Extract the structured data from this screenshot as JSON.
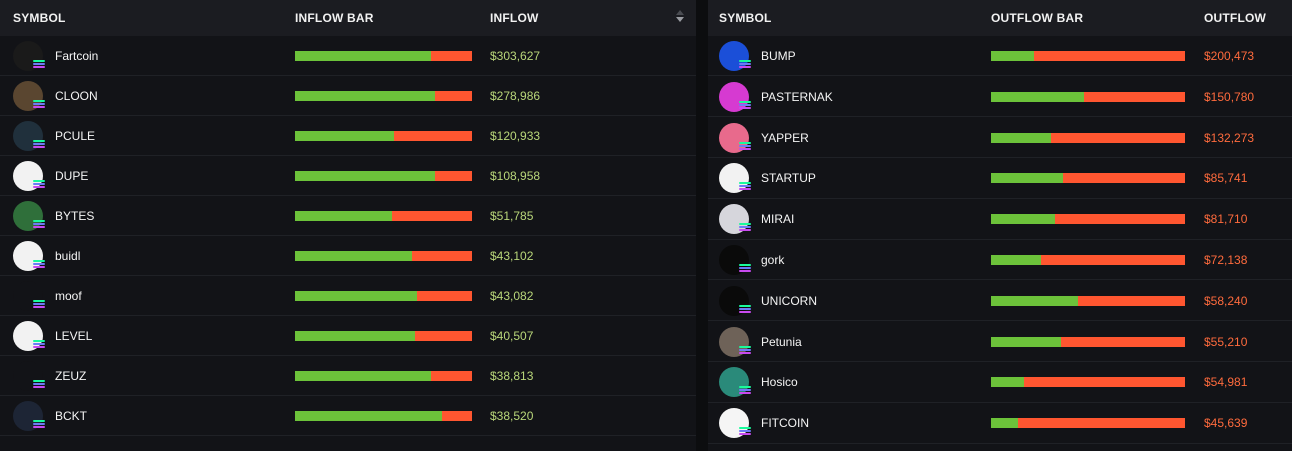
{
  "inflow_table": {
    "headers": {
      "symbol": "SYMBOL",
      "bar": "INFLOW BAR",
      "value": "INFLOW"
    },
    "rows": [
      {
        "symbol": "Fartcoin",
        "value": "$303,627",
        "green_fraction": 0.77,
        "avatar_color": "#1a1a1a"
      },
      {
        "symbol": "CLOON",
        "value": "$278,986",
        "green_fraction": 0.79,
        "avatar_color": "#5a4630"
      },
      {
        "symbol": "PCULE",
        "value": "$120,933",
        "green_fraction": 0.56,
        "avatar_color": "#20303c"
      },
      {
        "symbol": "DUPE",
        "value": "$108,958",
        "green_fraction": 0.79,
        "avatar_color": "#f2f2f2"
      },
      {
        "symbol": "BYTES",
        "value": "$51,785",
        "green_fraction": 0.55,
        "avatar_color": "#2f6f3a"
      },
      {
        "symbol": "buidl",
        "value": "$43,102",
        "green_fraction": 0.66,
        "avatar_color": "#f2f2f2"
      },
      {
        "symbol": "moof",
        "value": "$43,082",
        "green_fraction": 0.69,
        "avatar_color": "#121317"
      },
      {
        "symbol": "LEVEL",
        "value": "$40,507",
        "green_fraction": 0.68,
        "avatar_color": "#f2f2f2"
      },
      {
        "symbol": "ZEUZ",
        "value": "$38,813",
        "green_fraction": 0.77,
        "avatar_color": "#121317"
      },
      {
        "symbol": "BCKT",
        "value": "$38,520",
        "green_fraction": 0.83,
        "avatar_color": "#1d2535"
      }
    ]
  },
  "outflow_table": {
    "headers": {
      "symbol": "SYMBOL",
      "bar": "OUTFLOW BAR",
      "value": "OUTFLOW"
    },
    "rows": [
      {
        "symbol": "BUMP",
        "value": "$200,473",
        "green_fraction": 0.22,
        "avatar_color": "#1b4fd8"
      },
      {
        "symbol": "PASTERNAK",
        "value": "$150,780",
        "green_fraction": 0.48,
        "avatar_color": "#d63ad1"
      },
      {
        "symbol": "YAPPER",
        "value": "$132,273",
        "green_fraction": 0.31,
        "avatar_color": "#e86a8c"
      },
      {
        "symbol": "STARTUP",
        "value": "$85,741",
        "green_fraction": 0.37,
        "avatar_color": "#f2f2f2"
      },
      {
        "symbol": "MIRAI",
        "value": "$81,710",
        "green_fraction": 0.33,
        "avatar_color": "#d6d6dc"
      },
      {
        "symbol": "gork",
        "value": "$72,138",
        "green_fraction": 0.26,
        "avatar_color": "#0a0a0a"
      },
      {
        "symbol": "UNICORN",
        "value": "$58,240",
        "green_fraction": 0.45,
        "avatar_color": "#0a0a0a"
      },
      {
        "symbol": "Petunia",
        "value": "$55,210",
        "green_fraction": 0.36,
        "avatar_color": "#6e6258"
      },
      {
        "symbol": "Hosico",
        "value": "$54,981",
        "green_fraction": 0.17,
        "avatar_color": "#2a8a7a"
      },
      {
        "symbol": "FITCOIN",
        "value": "$45,639",
        "green_fraction": 0.14,
        "avatar_color": "#f5f5f5"
      }
    ]
  },
  "colors": {
    "inflow": "#6cc23a",
    "outflow": "#ff5630",
    "inflow_text": "#b9d77a",
    "outflow_text": "#ff6b3d"
  },
  "icons": {
    "sort": "sort-desc-icon",
    "chain_badge": "solana-badge-icon"
  }
}
